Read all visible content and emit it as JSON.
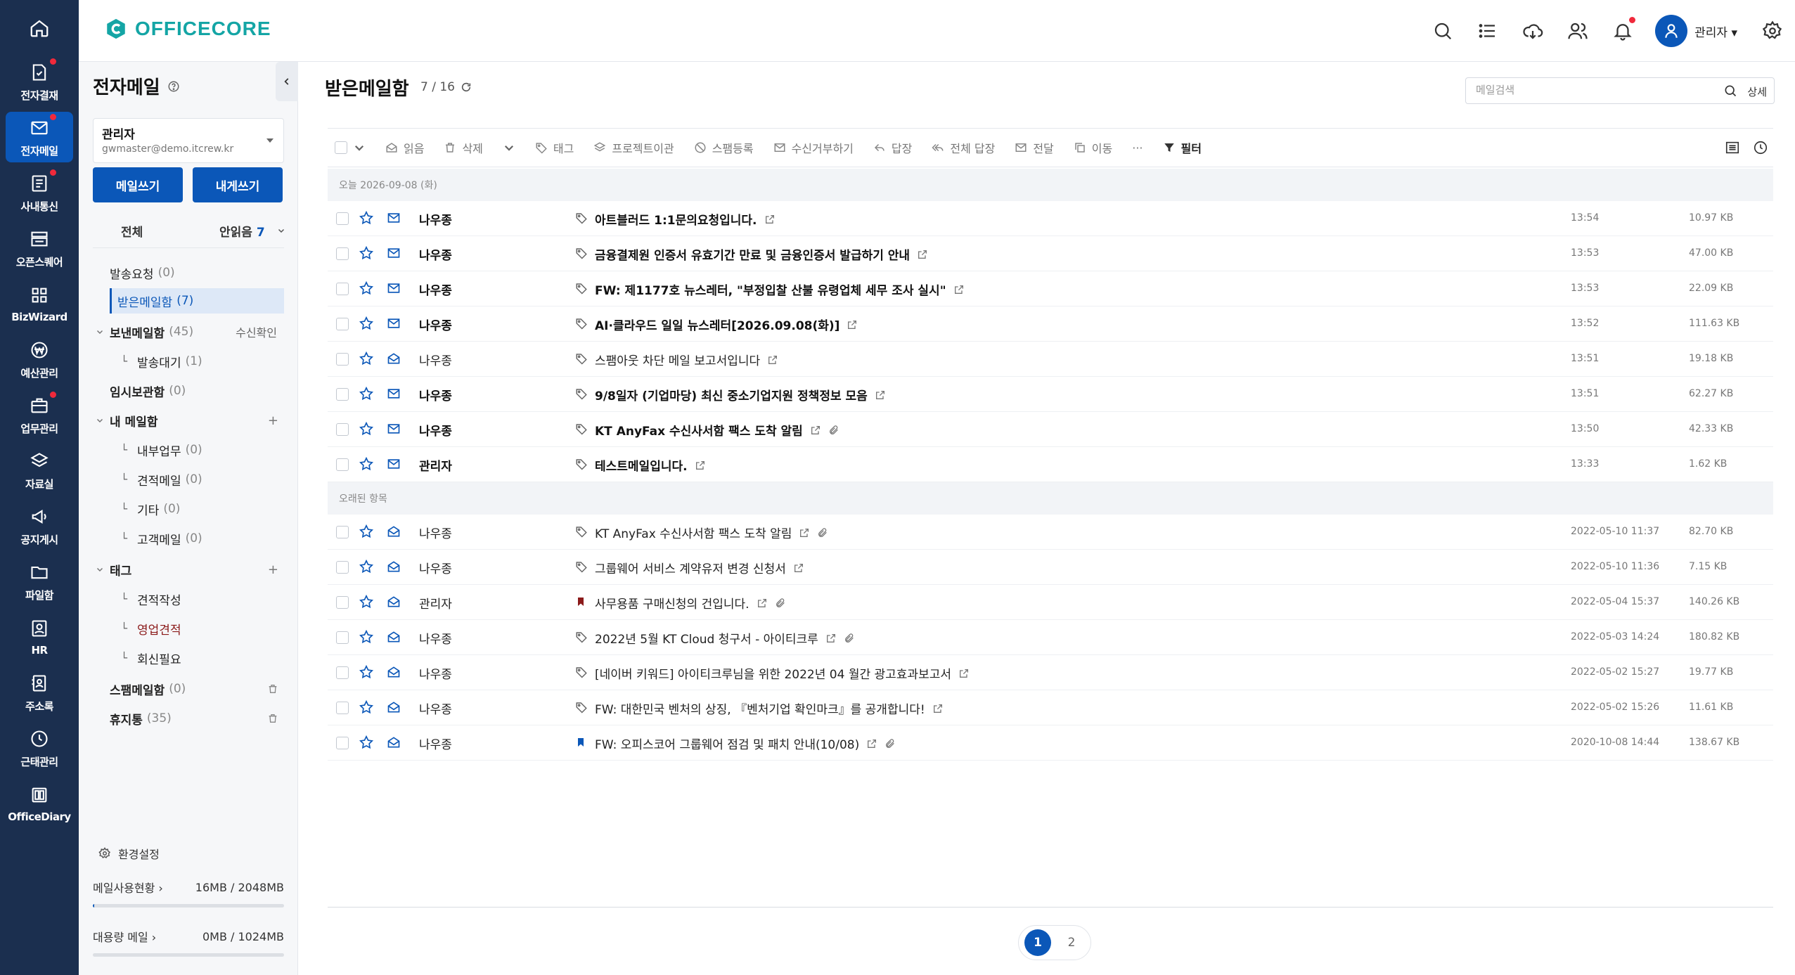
{
  "colors": {
    "rail_bg": "#1b2f4f",
    "accent": "#0b57b8",
    "brand": "#14a5a5",
    "notify_dot": "#f0293b"
  },
  "rail": {
    "home_icon": "home-icon",
    "items": [
      {
        "label": "전자결재",
        "icon": "approval-icon",
        "dot": true
      },
      {
        "label": "전자메일",
        "icon": "mail-icon",
        "dot": true,
        "active": true
      },
      {
        "label": "사내통신",
        "icon": "message-icon",
        "dot": true
      },
      {
        "label": "오픈스퀘어",
        "icon": "board-icon",
        "dot": false
      },
      {
        "label": "BizWizard",
        "icon": "grid-icon",
        "dot": false
      },
      {
        "label": "예산관리",
        "icon": "won-icon",
        "dot": false
      },
      {
        "label": "업무관리",
        "icon": "briefcase-icon",
        "dot": true
      },
      {
        "label": "자료실",
        "icon": "layers-icon",
        "dot": false
      },
      {
        "label": "공지게시",
        "icon": "megaphone-icon",
        "dot": false
      },
      {
        "label": "파일함",
        "icon": "folder-icon",
        "dot": false
      },
      {
        "label": "HR",
        "icon": "id-card-icon",
        "dot": false
      },
      {
        "label": "주소록",
        "icon": "address-book-icon",
        "dot": false
      },
      {
        "label": "근태관리",
        "icon": "clock-icon",
        "dot": false
      },
      {
        "label": "OfficeDiary",
        "icon": "diary-icon",
        "dot": false
      }
    ]
  },
  "header": {
    "brand": "OFFICECORE",
    "user": "관리자 ▾"
  },
  "sidebar": {
    "title": "전자메일",
    "account_name": "관리자",
    "account_email": "gwmaster@demo.itcrew.kr",
    "compose_label": "메일쓰기",
    "self_label": "내게쓰기",
    "filter_all": "전체",
    "filter_unread": "안읽음",
    "unread_count": "7",
    "folders": {
      "request": {
        "name": "발송요청",
        "count": "(0)"
      },
      "inbox": {
        "name": "받은메일함",
        "count": "(7)"
      },
      "sent": {
        "name": "보낸메일함",
        "count": "(45)",
        "extra": "수신확인"
      },
      "outbox": {
        "name": "발송대기",
        "count": "(1)"
      },
      "drafts": {
        "name": "임시보관함",
        "count": "(0)"
      },
      "my": {
        "name": "내 메일함"
      },
      "my_internal": {
        "name": "내부업무",
        "count": "(0)"
      },
      "my_quote": {
        "name": "견적메일",
        "count": "(0)"
      },
      "my_etc": {
        "name": "기타",
        "count": "(0)"
      },
      "my_client": {
        "name": "고객메일",
        "count": "(0)"
      },
      "tags": {
        "name": "태그"
      },
      "tag_quote": {
        "name": "견적작성"
      },
      "tag_sales": {
        "name": "영업견적"
      },
      "tag_reply": {
        "name": "회신필요"
      },
      "spam": {
        "name": "스팸메일함",
        "count": "(0)"
      },
      "trash": {
        "name": "휴지통",
        "count": "(35)"
      }
    },
    "settings": "환경설정",
    "usage_label": "메일사용현황",
    "usage_value": "16MB / 2048MB",
    "usage_fraction": 0.008,
    "bulk_label": "대용량 메일",
    "bulk_value": "0MB / 1024MB",
    "bulk_fraction": 0
  },
  "main": {
    "title": "받은메일함",
    "count": "7 / 16",
    "search_placeholder": "메일검색",
    "search_detail": "상세",
    "toolbar": {
      "read": "읽음",
      "delete": "삭제",
      "tag": "태그",
      "project": "프로젝트이관",
      "spam": "스팸등록",
      "reject": "수신거부하기",
      "reply": "답장",
      "reply_all": "전체 답장",
      "forward": "전달",
      "move": "이동",
      "more": "···",
      "filter": "필터"
    },
    "group_today": "오늘 2026-09-08 (화)",
    "group_old": "오래된 항목",
    "today": [
      {
        "from": "나우종",
        "subject": "아트블러드 1:1문의요청입니다.",
        "time": "13:54",
        "size": "10.97 KB"
      },
      {
        "from": "나우종",
        "subject": "금융결제원 인증서 유효기간 만료 및 금융인증서 발급하기 안내",
        "time": "13:53",
        "size": "47.00 KB"
      },
      {
        "from": "나우종",
        "subject": "FW: 제1177호 뉴스레터, \"부정입찰 산불 유령업체 세무 조사 실시\"",
        "time": "13:53",
        "size": "22.09 KB"
      },
      {
        "from": "나우종",
        "subject": "AI·클라우드 일일 뉴스레터[2026.09.08(화)]",
        "time": "13:52",
        "size": "111.63 KB"
      },
      {
        "from": "나우종",
        "subject": "스팸아웃 차단 메일 보고서입니다",
        "time": "13:51",
        "size": "19.18 KB"
      },
      {
        "from": "나우종",
        "subject": "9/8일자 (기업마당) 최신 중소기업지원 정책정보 모음",
        "time": "13:51",
        "size": "62.27 KB"
      },
      {
        "from": "나우종",
        "subject": "KT AnyFax 수신사서함 팩스 도착 알림",
        "time": "13:50",
        "size": "42.33 KB"
      },
      {
        "from": "관리자",
        "subject": "테스트메일입니다.",
        "time": "13:33",
        "size": "1.62 KB"
      }
    ],
    "old": [
      {
        "from": "나우종",
        "subject": "KT AnyFax 수신사서함 팩스 도착 알림",
        "time": "2022-05-10 11:37",
        "size": "82.70 KB"
      },
      {
        "from": "나우종",
        "subject": "그룹웨어 서비스 계약유저 변경 신청서",
        "time": "2022-05-10 11:36",
        "size": "7.15 KB"
      },
      {
        "from": "관리자",
        "subject": "사무용품 구매신청의 건입니다.",
        "time": "2022-05-04 15:37",
        "size": "140.26 KB"
      },
      {
        "from": "나우종",
        "subject": "2022년 5월 KT Cloud 청구서 - 아이티크루",
        "time": "2022-05-03 14:24",
        "size": "180.82 KB"
      },
      {
        "from": "나우종",
        "subject": "[네이버 키워드] 아이티크루님을 위한 2022년 04 월간 광고효과보고서",
        "time": "2022-05-02 15:27",
        "size": "19.77 KB"
      },
      {
        "from": "나우종",
        "subject": "FW: 대한민국 벤처의 상징, 『벤처기업 확인마크』를 공개합니다!",
        "time": "2022-05-02 15:26",
        "size": "11.61 KB"
      },
      {
        "from": "나우종",
        "subject": "FW: 오피스코어 그룹웨어 점검 및 패치 안내(10/08)",
        "time": "2020-10-08 14:44",
        "size": "138.67 KB"
      }
    ],
    "pages": [
      "1",
      "2"
    ]
  }
}
